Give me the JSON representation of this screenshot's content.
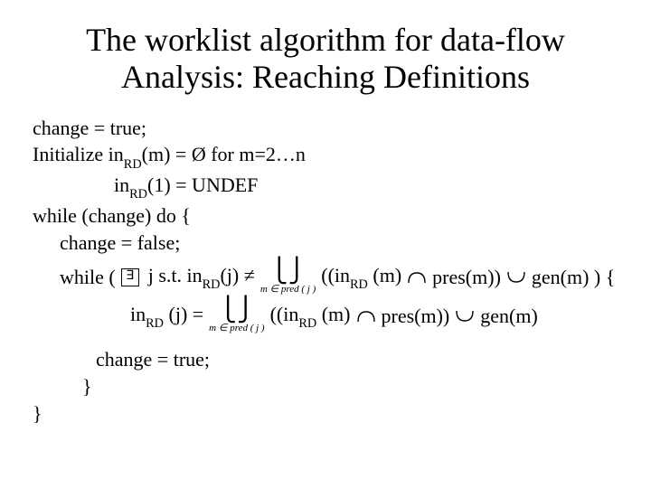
{
  "title": "The worklist algorithm for data-flow Analysis: Reaching Definitions",
  "alg": {
    "l1": "change = true;",
    "l2a": "Initialize in",
    "l2b": "(m) = Ø for m=2…n",
    "l3a": "in",
    "l3b": "(1) = UNDEF",
    "l4": "while (change) do {",
    "l5": "change = false;",
    "l6a": "while (",
    "l6b": " j s.t. in",
    "l6c": "(j) ≠ ",
    "l6d": " ((in",
    "l6e": " (m)",
    "l6f": "pres(m))",
    "l6g": "gen(m)  )  {",
    "l7a": "in",
    "l7b": " (j) = ",
    "l7c": "((in",
    "l7d": " (m)",
    "l7e": "pres(m))",
    "l7f": "gen(m)",
    "underscript": "m ∈ pred ( j )",
    "l8": "change = true;",
    "l9": "}",
    "l10": "}",
    "rd": "RD"
  }
}
